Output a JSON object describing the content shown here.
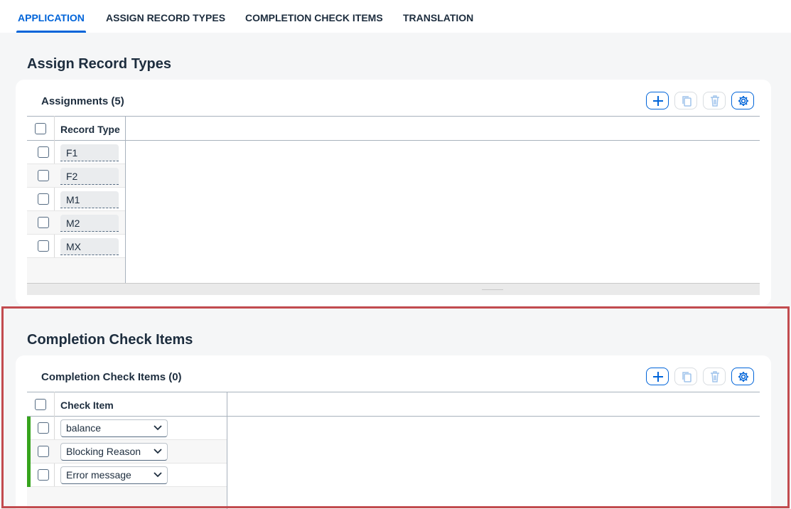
{
  "tabs": [
    {
      "label": "APPLICATION",
      "active": true
    },
    {
      "label": "ASSIGN RECORD TYPES",
      "active": false
    },
    {
      "label": "COMPLETION CHECK ITEMS",
      "active": false
    },
    {
      "label": "TRANSLATION",
      "active": false
    }
  ],
  "assign_section": {
    "title": "Assign Record Types",
    "card_title": "Assignments (5)",
    "column_header": "Record Type",
    "rows": [
      "F1",
      "F2",
      "M1",
      "M2",
      "MX"
    ]
  },
  "completion_section": {
    "title": "Completion Check Items",
    "card_title": "Completion Check Items (0)",
    "column_header": "Check Item",
    "rows": [
      "balance",
      "Blocking Reason",
      "Error message"
    ]
  },
  "icons": {
    "add": "plus-icon",
    "copy": "copy-icon",
    "delete": "trash-icon",
    "settings": "gear-icon",
    "dropdown": "chevron-down-icon"
  },
  "colors": {
    "accent": "#0064d9",
    "new_row_marker": "#36a41d",
    "highlight_border": "#c24b4f"
  }
}
